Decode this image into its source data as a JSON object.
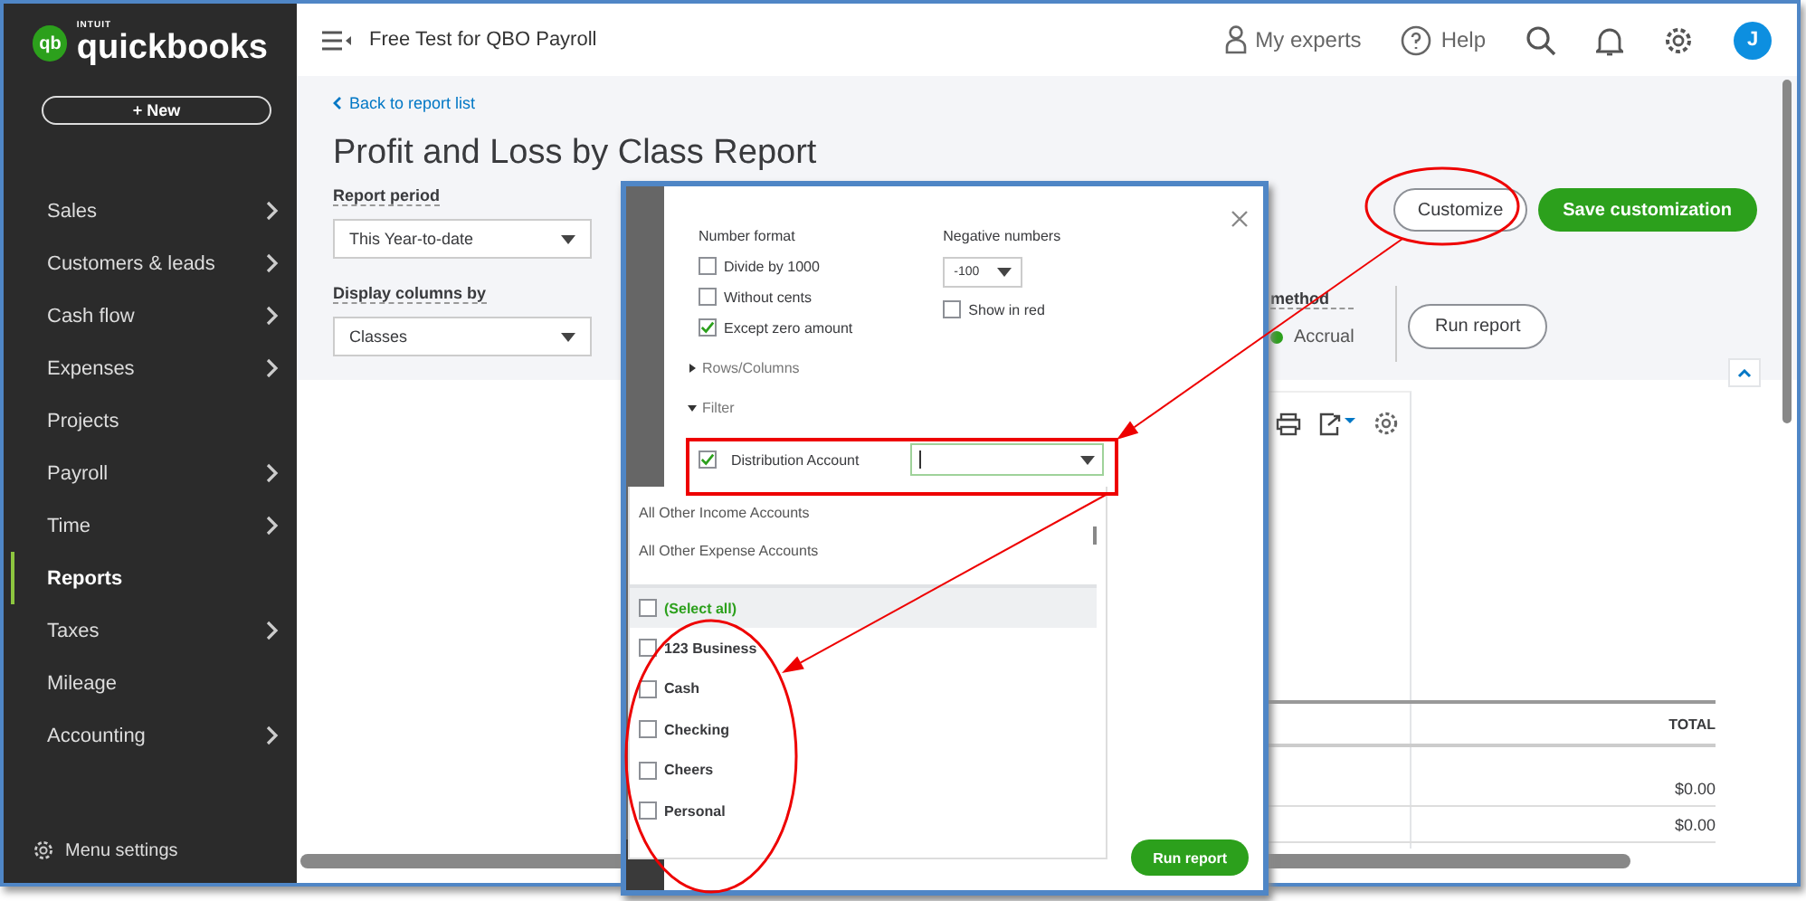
{
  "brand": {
    "mark": "qb",
    "company": "INTUIT",
    "name": "quickbooks"
  },
  "new_button": "+ New",
  "sidebar": {
    "items": [
      {
        "label": "Sales",
        "selected": false,
        "expandable": true
      },
      {
        "label": "Customers & leads",
        "selected": false,
        "expandable": true
      },
      {
        "label": "Cash flow",
        "selected": false,
        "expandable": true
      },
      {
        "label": "Expenses",
        "selected": false,
        "expandable": true
      },
      {
        "label": "Projects",
        "selected": false,
        "expandable": false
      },
      {
        "label": "Payroll",
        "selected": false,
        "expandable": true
      },
      {
        "label": "Time",
        "selected": false,
        "expandable": true
      },
      {
        "label": "Reports",
        "selected": true,
        "expandable": false
      },
      {
        "label": "Taxes",
        "selected": false,
        "expandable": true
      },
      {
        "label": "Mileage",
        "selected": false,
        "expandable": false
      },
      {
        "label": "Accounting",
        "selected": false,
        "expandable": true
      }
    ],
    "footer": "Menu settings"
  },
  "topbar": {
    "company": "Free Test for QBO Payroll",
    "experts": "My experts",
    "help": "Help",
    "avatar": "J"
  },
  "report": {
    "back_link": "Back to report list",
    "title": "Profit and Loss by Class Report",
    "period_label": "Report period",
    "period_value": "This Year-to-date",
    "columns_label": "Display columns by",
    "columns_value": "Classes",
    "method_label": "method",
    "method_option": {
      "label": "Accrual",
      "selected": true
    },
    "customize": "Customize",
    "save": "Save customization",
    "run": "Run report",
    "table": {
      "column": "TOTAL",
      "rows": [
        "$0.00",
        "$0.00"
      ]
    }
  },
  "customize_panel": {
    "number_format": "Number format",
    "checkboxes": [
      {
        "label": "Divide by 1000",
        "checked": false
      },
      {
        "label": "Without cents",
        "checked": false
      },
      {
        "label": "Except zero amount",
        "checked": true
      }
    ],
    "negative_label": "Negative numbers",
    "negative_value": "-100",
    "show_in_red": {
      "label": "Show in red",
      "checked": false
    },
    "sections": [
      {
        "label": "Rows/Columns",
        "expanded": false
      },
      {
        "label": "Filter",
        "expanded": true
      }
    ],
    "filter": {
      "label": "Distribution Account",
      "checked": true
    },
    "dropdown": {
      "groups": [
        "All Other Income Accounts",
        "All Other Expense Accounts"
      ],
      "select_all": {
        "label": "(Select all)",
        "checked": false
      },
      "items": [
        {
          "label": "123 Business",
          "checked": false
        },
        {
          "label": "Cash",
          "checked": false
        },
        {
          "label": "Checking",
          "checked": false
        },
        {
          "label": "Cheers",
          "checked": false
        },
        {
          "label": "Personal",
          "checked": false
        }
      ]
    },
    "run": "Run report"
  }
}
